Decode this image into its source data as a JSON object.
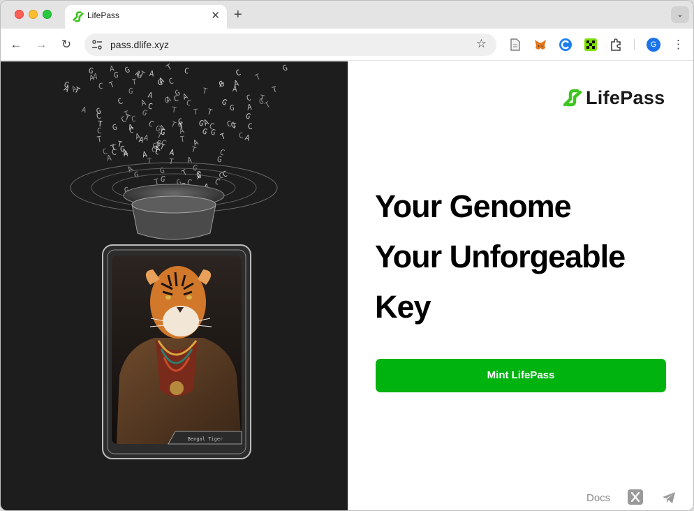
{
  "browser": {
    "tab_title": "LifePass",
    "tab_close": "✕",
    "new_tab": "+",
    "tab_menu": "⌄",
    "url": "pass.dlife.xyz",
    "back": "←",
    "forward": "→",
    "reload": "↻",
    "star": "☆",
    "avatar_letter": "G",
    "kebab": "⋮"
  },
  "artwork": {
    "card_caption": "Bengal Tiger",
    "dna_letters": "ATGCATGCTAGCTTAGCCGATAGCTAGCATCGATGCATGCTACGATCGTAGCTAGGCATCGATCGTAGCATCGGCTATGCATCGATGCTAGCATGCATCGACTGATCGATCGTAGCTAGCTAGCATGCTAGCATCGATCGATG"
  },
  "brand": {
    "name": "LifePass",
    "accent": "#00b30f",
    "logo_green": "#3ec51f"
  },
  "hero": {
    "line1": "Your Genome",
    "line2": "Your Unforgeable",
    "line3": "Key",
    "cta": "Mint LifePass"
  },
  "footer": {
    "docs": "Docs",
    "x_icon": "x-icon",
    "telegram_icon": "telegram-icon"
  }
}
